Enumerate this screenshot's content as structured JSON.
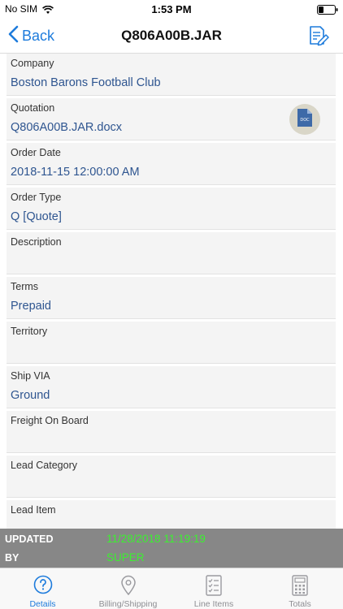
{
  "status_bar": {
    "carrier": "No SIM",
    "time": "1:53 PM"
  },
  "nav": {
    "back_label": "Back",
    "title": "Q806A00B.JAR"
  },
  "fields": [
    {
      "label": "Company",
      "value": "Boston Barons Football Club"
    },
    {
      "label": "Quotation",
      "value": "Q806A00B.JAR.docx"
    },
    {
      "label": "Order Date",
      "value": "2018-11-15 12:00:00 AM"
    },
    {
      "label": "Order Type",
      "value": "Q [Quote]"
    },
    {
      "label": "Description",
      "value": ""
    },
    {
      "label": "Terms",
      "value": "Prepaid"
    },
    {
      "label": "Territory",
      "value": ""
    },
    {
      "label": "Ship VIA",
      "value": "Ground"
    },
    {
      "label": "Freight On Board",
      "value": ""
    },
    {
      "label": "Lead Category",
      "value": ""
    },
    {
      "label": "Lead Item",
      "value": ""
    }
  ],
  "doc_badge": {
    "text": "DOC",
    "icon": "docx-file-icon"
  },
  "updated": {
    "updated_label": "UPDATED",
    "updated_value": "11/28/2018 11:19:19",
    "by_label": "BY",
    "by_value": "SUPER"
  },
  "tabs": [
    {
      "label": "Details",
      "icon": "question-circle-icon",
      "active": true
    },
    {
      "label": "Billing/Shipping",
      "icon": "map-pin-icon",
      "active": false
    },
    {
      "label": "Line Items",
      "icon": "checklist-icon",
      "active": false
    },
    {
      "label": "Totals",
      "icon": "calculator-icon",
      "active": false
    }
  ],
  "colors": {
    "accent": "#1d7bdc",
    "value_text": "#2e5590",
    "updated_value": "#3cf030",
    "updated_bar": "#878787"
  }
}
